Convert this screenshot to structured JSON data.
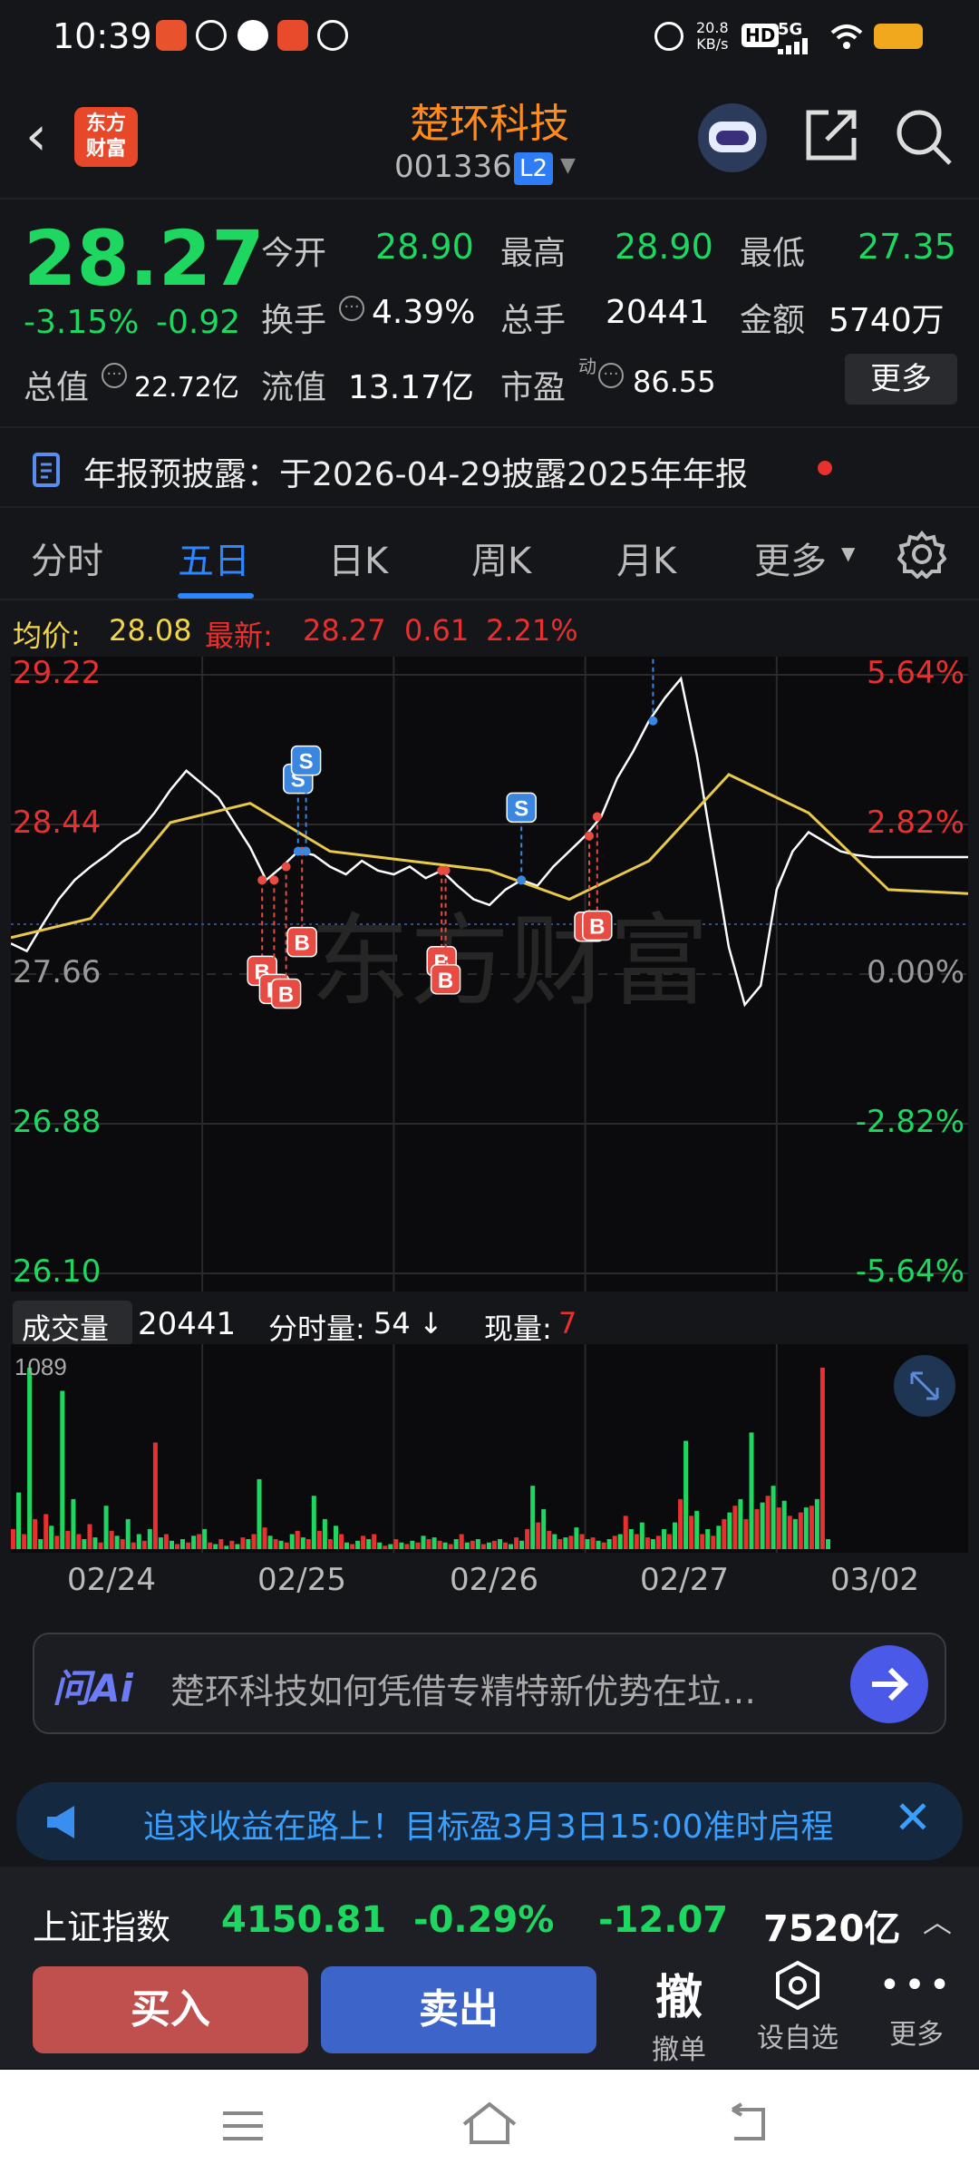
{
  "status": {
    "time": "10:39",
    "speed": "20.8",
    "speed_unit": "KB/s",
    "hd": "HD",
    "net": "5G"
  },
  "header": {
    "title": "楚环科技",
    "code": "001336",
    "level": "L2",
    "logo_line1": "东方",
    "logo_line2": "财富"
  },
  "quote": {
    "price": "28.27",
    "chg_pct": "-3.15%",
    "chg": "-0.92",
    "open_label": "今开",
    "open": "28.90",
    "high_label": "最高",
    "high": "28.90",
    "low_label": "最低",
    "low": "27.35",
    "turnover_label": "换手",
    "turnover": "4.39%",
    "volume_label": "总手",
    "volume": "20441",
    "amount_label": "金额",
    "amount": "5740万",
    "mktcap_label": "总值",
    "mktcap": "22.72亿",
    "float_label": "流值",
    "float": "13.17亿",
    "pe_label": "市盈",
    "pe_sup": "动",
    "pe": "86.55",
    "more": "更多"
  },
  "notice": {
    "text": "年报预披露：于2026-04-29披露2025年年报"
  },
  "tabs": [
    {
      "label": "分时"
    },
    {
      "label": "五日"
    },
    {
      "label": "日K"
    },
    {
      "label": "周K"
    },
    {
      "label": "月K"
    },
    {
      "label": "更多"
    }
  ],
  "info": {
    "avg_label": "均价:",
    "avg": "28.08",
    "last_label": "最新:",
    "last": "28.27",
    "diff": "0.61",
    "diff_pct": "2.21%"
  },
  "chart_data": {
    "type": "line",
    "title": "",
    "y_left_ticks": [
      "29.22",
      "28.44",
      "27.66",
      "26.88",
      "26.10"
    ],
    "y_right_ticks": [
      "5.64%",
      "2.82%",
      "0.00%",
      "-2.82%",
      "-5.64%"
    ],
    "ylim": [
      26.1,
      29.22
    ],
    "x_ticks": [
      "02/24",
      "02/25",
      "02/26",
      "02/27",
      "03/02"
    ],
    "watermark": "东方财富",
    "series": [
      {
        "x": [
          0,
          4,
          8,
          12,
          16,
          20,
          24,
          28,
          32,
          36,
          40,
          44,
          48,
          52,
          56,
          60,
          64,
          68,
          72,
          76,
          80,
          84,
          88,
          92,
          96,
          100,
          104,
          108,
          112,
          116,
          120,
          124,
          128,
          132,
          136,
          140,
          144,
          148,
          152,
          156,
          160,
          164,
          168,
          172,
          176,
          180,
          184,
          188,
          192,
          196,
          200,
          204,
          208,
          212,
          216,
          220,
          224,
          228,
          232,
          236,
          240
        ],
        "values": [
          27.82,
          27.78,
          27.92,
          28.05,
          28.15,
          28.22,
          28.28,
          28.35,
          28.4,
          28.5,
          28.62,
          28.72,
          28.65,
          28.58,
          28.45,
          28.32,
          28.15,
          28.22,
          28.3,
          28.28,
          28.22,
          28.18,
          28.25,
          28.2,
          28.18,
          28.22,
          28.16,
          28.2,
          28.12,
          28.05,
          28.02,
          28.1,
          28.15,
          28.12,
          28.22,
          28.3,
          28.38,
          28.48,
          28.68,
          28.82,
          28.98,
          29.1,
          29.2,
          28.8,
          28.3,
          27.8,
          27.5,
          27.6,
          28.1,
          28.3,
          28.4,
          28.35,
          28.3,
          28.28,
          28.27,
          28.27,
          28.27,
          28.27,
          28.27,
          28.27,
          28.27
        ]
      },
      {
        "x": [
          0,
          20,
          40,
          60,
          80,
          100,
          120,
          140,
          160,
          180,
          200,
          220,
          240
        ],
        "values": [
          27.85,
          27.95,
          28.45,
          28.55,
          28.3,
          28.25,
          28.2,
          28.05,
          28.25,
          28.7,
          28.5,
          28.1,
          28.08
        ]
      }
    ],
    "trade_marks": [
      {
        "x": 63,
        "type": "B"
      },
      {
        "x": 66,
        "type": "B"
      },
      {
        "x": 69,
        "type": "B"
      },
      {
        "x": 73,
        "type": "B"
      },
      {
        "x": 72,
        "type": "S"
      },
      {
        "x": 74,
        "type": "S"
      },
      {
        "x": 108,
        "type": "B"
      },
      {
        "x": 109,
        "type": "B"
      },
      {
        "x": 128,
        "type": "S"
      },
      {
        "x": 145,
        "type": "B"
      },
      {
        "x": 147,
        "type": "B"
      },
      {
        "x": 161,
        "type": "S"
      }
    ]
  },
  "volume": {
    "label": "成交量",
    "total": "20441",
    "fen_label": "分时量:",
    "fen": "54",
    "fen_arrow": "↓",
    "now_label": "现量:",
    "now": "7",
    "max_tick": "1089",
    "bars": [
      120,
      340,
      90,
      1089,
      180,
      60,
      210,
      140,
      80,
      950,
      110,
      300,
      90,
      60,
      150,
      70,
      40,
      260,
      110,
      80,
      60,
      180,
      40,
      90,
      50,
      120,
      640,
      70,
      90,
      50,
      30,
      60,
      40,
      80,
      90,
      120,
      40,
      30,
      60,
      20,
      50,
      30,
      70,
      60,
      90,
      420,
      130,
      80,
      60,
      50,
      40,
      90,
      110,
      70,
      60,
      320,
      110,
      180,
      60,
      140,
      90,
      40,
      30,
      50,
      80,
      60,
      90,
      40,
      20,
      30,
      60,
      40,
      30,
      50,
      40,
      80,
      60,
      70,
      50,
      40,
      30,
      60,
      90,
      40,
      50,
      60,
      30,
      40,
      50,
      60,
      40,
      30,
      70,
      50,
      120,
      380,
      160,
      240,
      110,
      90,
      60,
      70,
      80,
      130,
      90,
      60,
      70,
      50,
      40,
      60,
      80,
      90,
      200,
      120,
      90,
      160,
      70,
      60,
      80,
      120,
      90,
      160,
      300,
      650,
      200,
      230,
      90,
      120,
      80,
      140,
      180,
      220,
      260,
      300,
      180,
      700,
      240,
      280,
      320,
      380,
      250,
      290,
      200,
      180,
      220,
      250,
      260,
      300,
      1089,
      60
    ]
  },
  "ai": {
    "logo": "问Ai",
    "prompt": "楚环科技如何凭借专精特新优势在垃…"
  },
  "marquee": {
    "text": "追求收益在路上！目标盈3月3日15:00准时启程"
  },
  "index": {
    "name": "上证指数",
    "value": "4150.81",
    "pct": "-0.29%",
    "chg": "-12.07",
    "amount": "7520亿"
  },
  "actions": {
    "buy": "买入",
    "sell": "卖出",
    "cancel_icon": "撤",
    "cancel": "撤单",
    "watch": "设自选",
    "more": "更多"
  },
  "colors": {
    "up": "#e8302e",
    "down": "#1ed760",
    "accent": "#2e86ff",
    "name": "#ff8c1a",
    "avg_line": "#e8c94a"
  }
}
